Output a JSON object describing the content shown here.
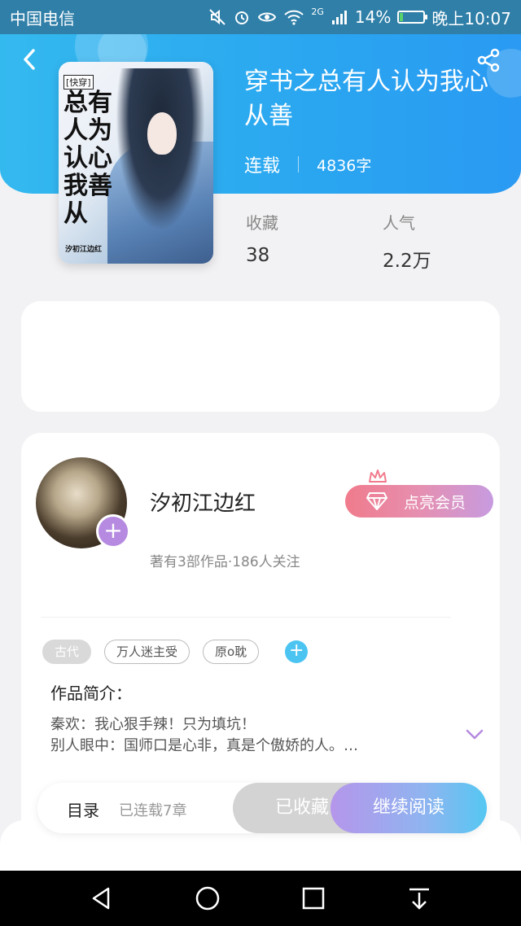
{
  "status_bar": {
    "carrier": "中国电信",
    "network": "2G",
    "battery": "14%",
    "battery_level": 0.14,
    "time": "晚上10:07"
  },
  "book": {
    "title": "穿书之总有人认为我心从善",
    "status": "连载",
    "word_count": "4836字",
    "cover": {
      "tag": "[快穿]",
      "title_art": "总有\n人为\n认心\n我善\n从",
      "author_art": "汐初江边红"
    }
  },
  "stats": {
    "favorites_label": "收藏",
    "favorites_value": "38",
    "popularity_label": "人气",
    "popularity_value": "2.2万"
  },
  "author": {
    "name": "汐初江边红",
    "info": "著有3部作品·186人关注",
    "vip_label": "点亮会员"
  },
  "tags": [
    "古代",
    "万人迷主受",
    "原o耽"
  ],
  "intro": {
    "title": "作品简介：",
    "text": "秦欢：我心狠手辣！只为填坑！\n别人眼中：国师口是心非，真是个傲娇的人。…"
  },
  "actions": {
    "toc_label": "目录",
    "chapters": "已连载7章",
    "favorited_label": "已收藏",
    "read_label": "继续阅读"
  },
  "colors": {
    "hero": "#2aa6f0",
    "accent_purple": "#b58ae0",
    "vip_pink": "#f07b8c"
  }
}
